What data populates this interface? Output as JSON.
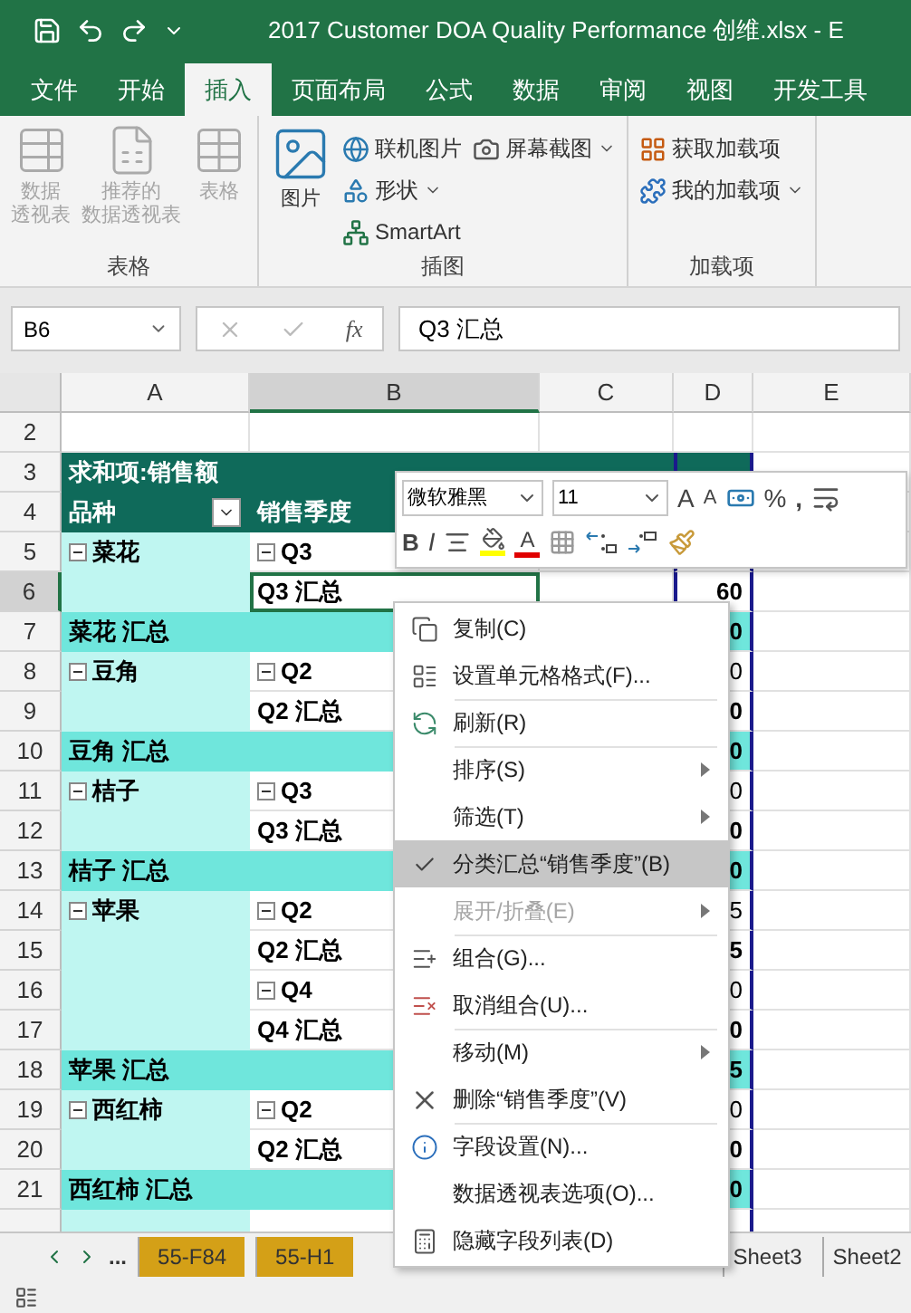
{
  "title_bar": {
    "title": "2017 Customer DOA Quality Performance 创维.xlsx  -  E"
  },
  "ribbon_tabs": [
    {
      "label": "文件",
      "selected": false
    },
    {
      "label": "开始",
      "selected": false
    },
    {
      "label": "插入",
      "selected": true
    },
    {
      "label": "页面布局",
      "selected": false
    },
    {
      "label": "公式",
      "selected": false
    },
    {
      "label": "数据",
      "selected": false
    },
    {
      "label": "审阅",
      "selected": false
    },
    {
      "label": "视图",
      "selected": false
    },
    {
      "label": "开发工具",
      "selected": false
    }
  ],
  "ribbon_groups": [
    {
      "label": "表格",
      "buttons": [
        {
          "kind": "large",
          "lines": [
            "数据",
            "透视表"
          ],
          "disabled": true
        },
        {
          "kind": "large",
          "lines": [
            "推荐的",
            "数据透视表"
          ],
          "disabled": true
        },
        {
          "kind": "large",
          "lines": [
            "表格"
          ],
          "disabled": true
        }
      ]
    },
    {
      "label": "插图",
      "buttons": [
        {
          "kind": "large",
          "lines": [
            "图片"
          ],
          "disabled": false
        },
        {
          "kind": "small",
          "label": "联机图片",
          "dropdown": false
        },
        {
          "kind": "small",
          "label": "形状",
          "dropdown": true
        },
        {
          "kind": "small",
          "label": "SmartArt",
          "dropdown": false
        },
        {
          "kind": "small",
          "label": "屏幕截图",
          "dropdown": true
        }
      ]
    },
    {
      "label": "加载项",
      "buttons": [
        {
          "kind": "small",
          "label": "获取加载项",
          "dropdown": false
        },
        {
          "kind": "small",
          "label": "我的加载项",
          "dropdown": true
        }
      ]
    }
  ],
  "formula_bar": {
    "name_box": "B6",
    "fx": "fx",
    "formula": "Q3 汇总"
  },
  "columns": [
    {
      "label": "A",
      "selected": false
    },
    {
      "label": "B",
      "selected": true
    },
    {
      "label": "C",
      "selected": false
    },
    {
      "label": "D",
      "selected": false
    },
    {
      "label": "E",
      "selected": false
    }
  ],
  "rows": [
    {
      "number": "2",
      "kind": "blank",
      "selected": false
    },
    {
      "number": "3",
      "kind": "title",
      "selected": false,
      "text": "求和项:销售额"
    },
    {
      "number": "4",
      "kind": "fields",
      "selected": false,
      "a": "品种",
      "b": "销售季度"
    },
    {
      "number": "5",
      "kind": "detail",
      "selected": false,
      "a": {
        "text": "菜花",
        "expanded": true
      },
      "b": {
        "kind": "group",
        "text": "Q3",
        "expanded": true,
        "selected": false
      }
    },
    {
      "number": "6",
      "kind": "detail",
      "selected": true,
      "b": {
        "kind": "subtotal",
        "text": "Q3 汇总",
        "selected": true
      },
      "d": "60"
    },
    {
      "number": "7",
      "kind": "total",
      "selected": false,
      "text": "菜花 汇总",
      "d": "0"
    },
    {
      "number": "8",
      "kind": "detail",
      "selected": false,
      "a": {
        "text": "豆角",
        "expanded": true
      },
      "b": {
        "kind": "group",
        "text": "Q2",
        "expanded": true,
        "selected": false
      },
      "d": "0"
    },
    {
      "number": "9",
      "kind": "detail",
      "selected": false,
      "b": {
        "kind": "subtotal",
        "text": "Q2 汇总",
        "selected": false
      },
      "d": "0"
    },
    {
      "number": "10",
      "kind": "total",
      "selected": false,
      "text": "豆角 汇总",
      "d": "0"
    },
    {
      "number": "11",
      "kind": "detail",
      "selected": false,
      "a": {
        "text": "桔子",
        "expanded": true
      },
      "b": {
        "kind": "group",
        "text": "Q3",
        "expanded": true,
        "selected": false
      },
      "d": "0"
    },
    {
      "number": "12",
      "kind": "detail",
      "selected": false,
      "b": {
        "kind": "subtotal",
        "text": "Q3 汇总",
        "selected": false
      },
      "d": "0"
    },
    {
      "number": "13",
      "kind": "total",
      "selected": false,
      "text": "桔子 汇总",
      "d": "0"
    },
    {
      "number": "14",
      "kind": "detail",
      "selected": false,
      "a": {
        "text": "苹果",
        "expanded": true
      },
      "b": {
        "kind": "group",
        "text": "Q2",
        "expanded": true,
        "selected": false
      },
      "d": "5"
    },
    {
      "number": "15",
      "kind": "detail",
      "selected": false,
      "b": {
        "kind": "subtotal",
        "text": "Q2 汇总",
        "selected": false
      },
      "d": "5"
    },
    {
      "number": "16",
      "kind": "detail",
      "selected": false,
      "b": {
        "kind": "group",
        "text": "Q4",
        "expanded": true,
        "selected": false
      },
      "d": "0"
    },
    {
      "number": "17",
      "kind": "detail",
      "selected": false,
      "b": {
        "kind": "subtotal",
        "text": "Q4 汇总",
        "selected": false
      },
      "d": "0"
    },
    {
      "number": "18",
      "kind": "total",
      "selected": false,
      "text": "苹果 汇总",
      "d": "5"
    },
    {
      "number": "19",
      "kind": "detail",
      "selected": false,
      "a": {
        "text": "西红柿",
        "expanded": true
      },
      "b": {
        "kind": "group",
        "text": "Q2",
        "expanded": true,
        "selected": false
      },
      "d": "0"
    },
    {
      "number": "20",
      "kind": "detail",
      "selected": false,
      "b": {
        "kind": "subtotal",
        "text": "Q2 汇总",
        "selected": false
      },
      "d": "0"
    },
    {
      "number": "21",
      "kind": "total",
      "selected": false,
      "text": "西红柿 汇总",
      "d": "0"
    },
    {
      "kind": "partial",
      "selected": false
    }
  ],
  "mini_toolbar": {
    "font": "微软雅黑",
    "size": "11",
    "grow": "A",
    "shrink": "A",
    "percent": "%",
    "comma": ",",
    "bold": "B",
    "italic": "I",
    "font_color": "A"
  },
  "context_menu": [
    {
      "label": "复制(C)",
      "divider_above": false,
      "checked": false,
      "selected": false,
      "disabled": false,
      "submenu": false
    },
    {
      "label": "设置单元格格式(F)...",
      "divider_above": false,
      "checked": false,
      "selected": false,
      "disabled": false,
      "submenu": false
    },
    {
      "label": "刷新(R)",
      "divider_above": true,
      "checked": false,
      "selected": false,
      "disabled": false,
      "submenu": false
    },
    {
      "label": "排序(S)",
      "divider_above": true,
      "checked": false,
      "selected": false,
      "disabled": false,
      "submenu": true
    },
    {
      "label": "筛选(T)",
      "divider_above": false,
      "checked": false,
      "selected": false,
      "disabled": false,
      "submenu": true
    },
    {
      "label": "分类汇总“销售季度”(B)",
      "divider_above": false,
      "checked": true,
      "selected": true,
      "disabled": false,
      "submenu": false
    },
    {
      "label": "展开/折叠(E)",
      "divider_above": false,
      "checked": false,
      "selected": false,
      "disabled": true,
      "submenu": true
    },
    {
      "label": "组合(G)...",
      "divider_above": true,
      "checked": false,
      "selected": false,
      "disabled": false,
      "submenu": false
    },
    {
      "label": "取消组合(U)...",
      "divider_above": false,
      "checked": false,
      "selected": false,
      "disabled": false,
      "submenu": false
    },
    {
      "label": "移动(M)",
      "divider_above": true,
      "checked": false,
      "selected": false,
      "disabled": false,
      "submenu": true
    },
    {
      "label": "删除“销售季度”(V)",
      "divider_above": false,
      "checked": false,
      "selected": false,
      "disabled": false,
      "submenu": false
    },
    {
      "label": "字段设置(N)...",
      "divider_above": true,
      "checked": false,
      "selected": false,
      "disabled": false,
      "submenu": false
    },
    {
      "label": "数据透视表选项(O)...",
      "divider_above": false,
      "checked": false,
      "selected": false,
      "disabled": false,
      "submenu": false
    },
    {
      "label": "隐藏字段列表(D)",
      "divider_above": false,
      "checked": false,
      "selected": false,
      "disabled": false,
      "submenu": false
    }
  ],
  "sheet_tabs": {
    "more": "...",
    "tabs": [
      {
        "label": "55-F84",
        "color": "#d4a017"
      },
      {
        "label": "55-H1",
        "color": "#d4a017"
      },
      {
        "label": "Sheet3"
      },
      {
        "label": "Sheet2"
      }
    ]
  }
}
